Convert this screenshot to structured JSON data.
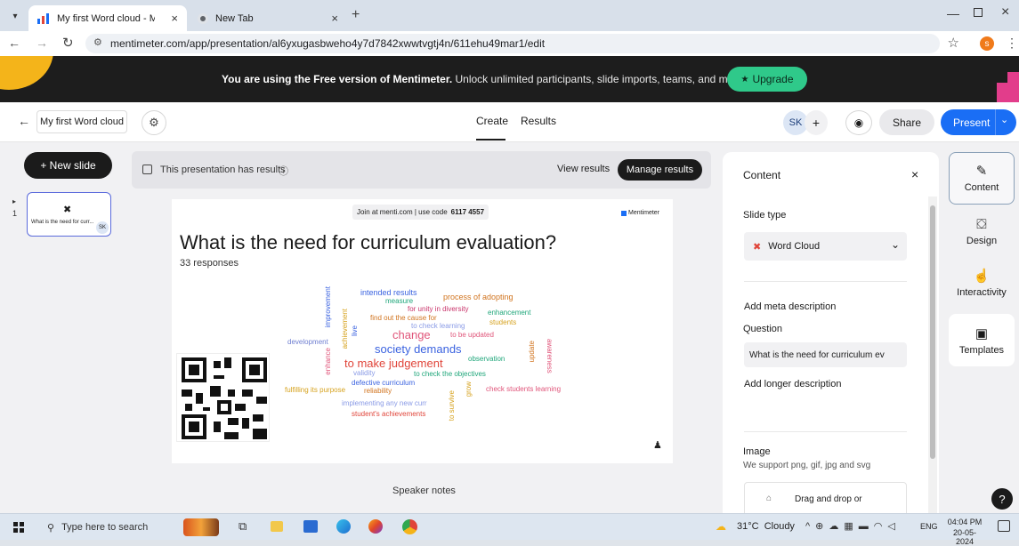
{
  "browser": {
    "tabs": [
      {
        "title": "My first Word cloud - Mentimeter"
      },
      {
        "title": "New Tab"
      }
    ],
    "url": "mentimeter.com/app/presentation/al6yxugasbweho4y7d7842xwwtvgtj4n/611ehu49mar1/edit",
    "profile_initial": "s"
  },
  "banner": {
    "lead": "You are using the Free version of Mentimeter.",
    "rest": " Unlock unlimited participants, slide imports, teams, and more.",
    "upgrade_label": "Upgrade"
  },
  "appbar": {
    "presentation_title": "My first Word cloud",
    "tabs": [
      {
        "label": "Create"
      },
      {
        "label": "Results"
      }
    ],
    "avatar_initials": "SK",
    "share_label": "Share",
    "present_label": "Present"
  },
  "left": {
    "new_slide_label": "+ New slide",
    "slide_number": "1",
    "thumb_caption": "What is the need for curr...",
    "thumb_badge": "SK"
  },
  "results_bar": {
    "message": "This presentation has results",
    "view_results": "View results",
    "manage_results": "Manage results"
  },
  "slide": {
    "join_text": "Join at menti.com | use code",
    "code": "6117 4557",
    "brand": "Mentimeter",
    "question": "What is the need for curriculum evaluation?",
    "responses": "33 responses",
    "speaker_notes": "Speaker notes"
  },
  "wordcloud": [
    {
      "text": "intended results",
      "color": "#3b63e0"
    },
    {
      "text": "process of adopting",
      "color": "#d1741f"
    },
    {
      "text": "measure",
      "color": "#1fa67a"
    },
    {
      "text": "for unity in diversity",
      "color": "#c9356b"
    },
    {
      "text": "improvement",
      "color": "#3b63e0"
    },
    {
      "text": "achievement",
      "color": "#d6a21e"
    },
    {
      "text": "enhancement",
      "color": "#1fa67a"
    },
    {
      "text": "find out the cause for",
      "color": "#d1741f"
    },
    {
      "text": "students",
      "color": "#d6a21e"
    },
    {
      "text": "live",
      "color": "#3b63e0"
    },
    {
      "text": "to check learning",
      "color": "#8a9be6"
    },
    {
      "text": "change",
      "color": "#e0557a"
    },
    {
      "text": "to be updated",
      "color": "#e0557a"
    },
    {
      "text": "development",
      "color": "#6f7fd1"
    },
    {
      "text": "society demands",
      "color": "#3b63e0"
    },
    {
      "text": "update",
      "color": "#d1741f"
    },
    {
      "text": "awareness",
      "color": "#e0557a"
    },
    {
      "text": "enhance",
      "color": "#e0557a"
    },
    {
      "text": "to make judgement",
      "color": "#e0453a"
    },
    {
      "text": "observation",
      "color": "#1fa67a"
    },
    {
      "text": "validity",
      "color": "#8a9be6"
    },
    {
      "text": "to check the objectives",
      "color": "#1fa67a"
    },
    {
      "text": "defective curriculum",
      "color": "#3b63e0"
    },
    {
      "text": "fulfilling its purpose",
      "color": "#d6a21e"
    },
    {
      "text": "reliability",
      "color": "#d1741f"
    },
    {
      "text": "grow",
      "color": "#d6a21e"
    },
    {
      "text": "check students learning",
      "color": "#e0557a"
    },
    {
      "text": "implementing any new curr",
      "color": "#8a9be6"
    },
    {
      "text": "to survive",
      "color": "#d6a21e"
    },
    {
      "text": "student's achievements",
      "color": "#e0453a"
    }
  ],
  "panel": {
    "title": "Content",
    "slide_type_label": "Slide type",
    "slide_type_value": "Word Cloud",
    "meta_description": "Add meta description",
    "question_label": "Question",
    "question_value": "What is the need for curriculum ev",
    "longer_description": "Add longer description",
    "image_label": "Image",
    "image_hint": "We support png, gif, jpg and svg",
    "drop_label": "Drag and drop or"
  },
  "rightbar": [
    {
      "label": "Content"
    },
    {
      "label": "Design"
    },
    {
      "label": "Interactivity"
    },
    {
      "label": "Templates"
    }
  ],
  "taskbar": {
    "search_placeholder": "Type here to search",
    "weather": "31°C  Cloudy",
    "lang": "ENG",
    "time": "04:04 PM",
    "date": "20-05-2024"
  },
  "colors": {
    "accent_blue": "#1a6ef5",
    "upgrade_green": "#2fc98a",
    "banner_bg": "#1d1d1d"
  }
}
